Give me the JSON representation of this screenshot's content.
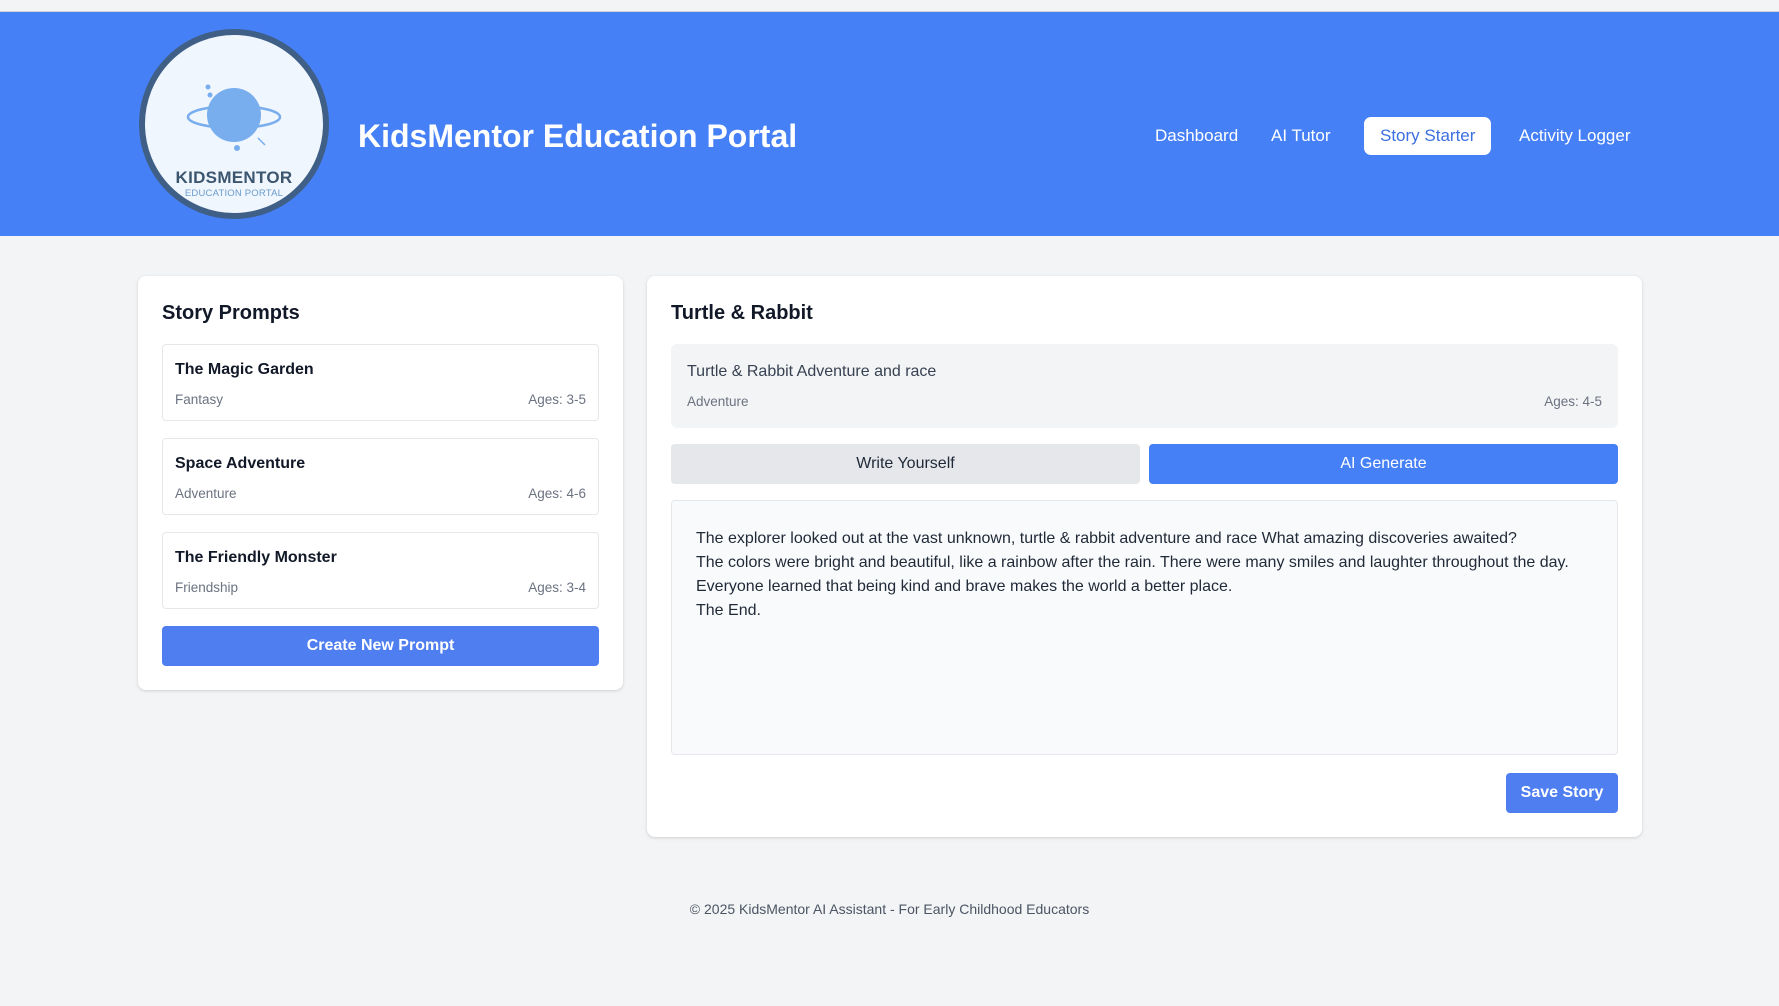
{
  "header": {
    "logo_name": "KIDSMENTOR",
    "logo_sub": "EDUCATION PORTAL",
    "title": "KidsMentor Education Portal",
    "nav": [
      {
        "label": "Dashboard",
        "active": false
      },
      {
        "label": "AI Tutor",
        "active": false
      },
      {
        "label": "Story Starter",
        "active": true
      },
      {
        "label": "Activity Logger",
        "active": false
      }
    ]
  },
  "colors": {
    "header_bg": "#4680f6",
    "primary_button": "#4f7ef0",
    "page_bg": "#f3f4f6"
  },
  "prompts_panel": {
    "title": "Story Prompts",
    "items": [
      {
        "title": "The Magic Garden",
        "genre": "Fantasy",
        "ages": "Ages: 3-5"
      },
      {
        "title": "Space Adventure",
        "genre": "Adventure",
        "ages": "Ages: 4-6"
      },
      {
        "title": "The Friendly Monster",
        "genre": "Friendship",
        "ages": "Ages: 3-4"
      }
    ],
    "create_label": "Create New Prompt"
  },
  "story_panel": {
    "title": "Turtle & Rabbit",
    "selected": {
      "text": "Turtle & Rabbit Adventure and race",
      "genre": "Adventure",
      "ages": "Ages: 4-5"
    },
    "mode_write_label": "Write Yourself",
    "mode_ai_label": "AI Generate",
    "active_mode": "AI Generate",
    "story_text": "The explorer looked out at the vast unknown, turtle & rabbit adventure and race What amazing discoveries awaited?\nThe colors were bright and beautiful, like a rainbow after the rain. There were many smiles and laughter throughout the day.\nEveryone learned that being kind and brave makes the world a better place.\nThe End.",
    "save_label": "Save Story"
  },
  "footer": {
    "text": "© 2025 KidsMentor AI Assistant - For Early Childhood Educators"
  }
}
